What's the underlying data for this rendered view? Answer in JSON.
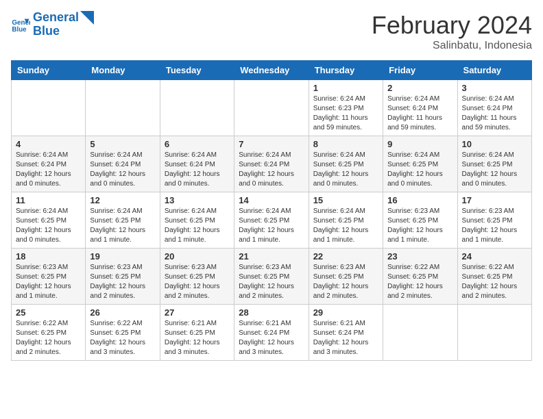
{
  "header": {
    "logo_line1": "General",
    "logo_line2": "Blue",
    "month_year": "February 2024",
    "location": "Salinbatu, Indonesia"
  },
  "days_of_week": [
    "Sunday",
    "Monday",
    "Tuesday",
    "Wednesday",
    "Thursday",
    "Friday",
    "Saturday"
  ],
  "weeks": [
    [
      {
        "day": "",
        "info": ""
      },
      {
        "day": "",
        "info": ""
      },
      {
        "day": "",
        "info": ""
      },
      {
        "day": "",
        "info": ""
      },
      {
        "day": "1",
        "info": "Sunrise: 6:24 AM\nSunset: 6:23 PM\nDaylight: 11 hours\nand 59 minutes."
      },
      {
        "day": "2",
        "info": "Sunrise: 6:24 AM\nSunset: 6:24 PM\nDaylight: 11 hours\nand 59 minutes."
      },
      {
        "day": "3",
        "info": "Sunrise: 6:24 AM\nSunset: 6:24 PM\nDaylight: 11 hours\nand 59 minutes."
      }
    ],
    [
      {
        "day": "4",
        "info": "Sunrise: 6:24 AM\nSunset: 6:24 PM\nDaylight: 12 hours\nand 0 minutes."
      },
      {
        "day": "5",
        "info": "Sunrise: 6:24 AM\nSunset: 6:24 PM\nDaylight: 12 hours\nand 0 minutes."
      },
      {
        "day": "6",
        "info": "Sunrise: 6:24 AM\nSunset: 6:24 PM\nDaylight: 12 hours\nand 0 minutes."
      },
      {
        "day": "7",
        "info": "Sunrise: 6:24 AM\nSunset: 6:24 PM\nDaylight: 12 hours\nand 0 minutes."
      },
      {
        "day": "8",
        "info": "Sunrise: 6:24 AM\nSunset: 6:25 PM\nDaylight: 12 hours\nand 0 minutes."
      },
      {
        "day": "9",
        "info": "Sunrise: 6:24 AM\nSunset: 6:25 PM\nDaylight: 12 hours\nand 0 minutes."
      },
      {
        "day": "10",
        "info": "Sunrise: 6:24 AM\nSunset: 6:25 PM\nDaylight: 12 hours\nand 0 minutes."
      }
    ],
    [
      {
        "day": "11",
        "info": "Sunrise: 6:24 AM\nSunset: 6:25 PM\nDaylight: 12 hours\nand 0 minutes."
      },
      {
        "day": "12",
        "info": "Sunrise: 6:24 AM\nSunset: 6:25 PM\nDaylight: 12 hours\nand 1 minute."
      },
      {
        "day": "13",
        "info": "Sunrise: 6:24 AM\nSunset: 6:25 PM\nDaylight: 12 hours\nand 1 minute."
      },
      {
        "day": "14",
        "info": "Sunrise: 6:24 AM\nSunset: 6:25 PM\nDaylight: 12 hours\nand 1 minute."
      },
      {
        "day": "15",
        "info": "Sunrise: 6:24 AM\nSunset: 6:25 PM\nDaylight: 12 hours\nand 1 minute."
      },
      {
        "day": "16",
        "info": "Sunrise: 6:23 AM\nSunset: 6:25 PM\nDaylight: 12 hours\nand 1 minute."
      },
      {
        "day": "17",
        "info": "Sunrise: 6:23 AM\nSunset: 6:25 PM\nDaylight: 12 hours\nand 1 minute."
      }
    ],
    [
      {
        "day": "18",
        "info": "Sunrise: 6:23 AM\nSunset: 6:25 PM\nDaylight: 12 hours\nand 1 minute."
      },
      {
        "day": "19",
        "info": "Sunrise: 6:23 AM\nSunset: 6:25 PM\nDaylight: 12 hours\nand 2 minutes."
      },
      {
        "day": "20",
        "info": "Sunrise: 6:23 AM\nSunset: 6:25 PM\nDaylight: 12 hours\nand 2 minutes."
      },
      {
        "day": "21",
        "info": "Sunrise: 6:23 AM\nSunset: 6:25 PM\nDaylight: 12 hours\nand 2 minutes."
      },
      {
        "day": "22",
        "info": "Sunrise: 6:23 AM\nSunset: 6:25 PM\nDaylight: 12 hours\nand 2 minutes."
      },
      {
        "day": "23",
        "info": "Sunrise: 6:22 AM\nSunset: 6:25 PM\nDaylight: 12 hours\nand 2 minutes."
      },
      {
        "day": "24",
        "info": "Sunrise: 6:22 AM\nSunset: 6:25 PM\nDaylight: 12 hours\nand 2 minutes."
      }
    ],
    [
      {
        "day": "25",
        "info": "Sunrise: 6:22 AM\nSunset: 6:25 PM\nDaylight: 12 hours\nand 2 minutes."
      },
      {
        "day": "26",
        "info": "Sunrise: 6:22 AM\nSunset: 6:25 PM\nDaylight: 12 hours\nand 3 minutes."
      },
      {
        "day": "27",
        "info": "Sunrise: 6:21 AM\nSunset: 6:25 PM\nDaylight: 12 hours\nand 3 minutes."
      },
      {
        "day": "28",
        "info": "Sunrise: 6:21 AM\nSunset: 6:24 PM\nDaylight: 12 hours\nand 3 minutes."
      },
      {
        "day": "29",
        "info": "Sunrise: 6:21 AM\nSunset: 6:24 PM\nDaylight: 12 hours\nand 3 minutes."
      },
      {
        "day": "",
        "info": ""
      },
      {
        "day": "",
        "info": ""
      }
    ]
  ]
}
